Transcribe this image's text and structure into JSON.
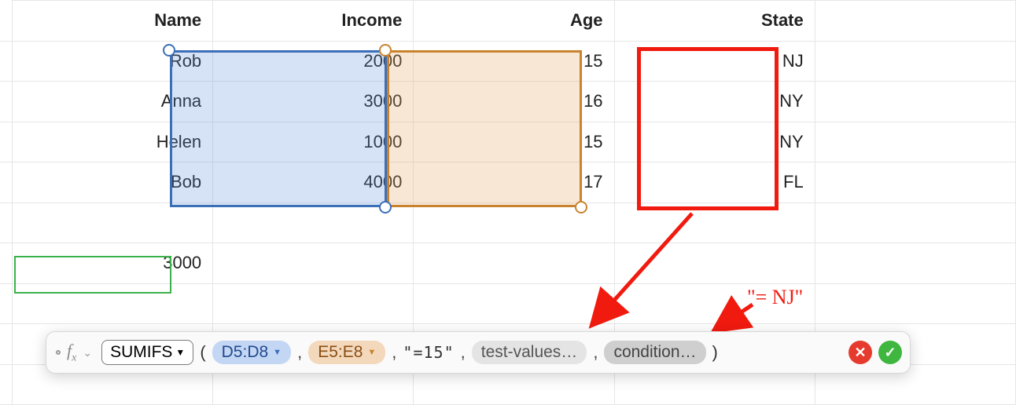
{
  "headers": {
    "name": "Name",
    "income": "Income",
    "age": "Age",
    "state": "State"
  },
  "rows": [
    {
      "name": "Rob",
      "income": "2000",
      "age": "15",
      "state": "NJ"
    },
    {
      "name": "Anna",
      "income": "3000",
      "age": "16",
      "state": "NY"
    },
    {
      "name": "Helen",
      "income": "1000",
      "age": "15",
      "state": "NY"
    },
    {
      "name": "Bob",
      "income": "4000",
      "age": "17",
      "state": "FL"
    }
  ],
  "result_cell": "3000",
  "annotation": "\"= NJ\"",
  "formula": {
    "function": "SUMIFS",
    "range1": "D5:D8",
    "range2": "E5:E8",
    "literal": "\"=15\"",
    "placeholder1": "test-values…",
    "placeholder2": "condition…"
  },
  "glyphs": {
    "fx": "f",
    "fx_sub": "x",
    "dropdown": "▼",
    "caret": "⌄",
    "cancel": "✕",
    "confirm": "✓",
    "paren_open": "(",
    "paren_close": ")",
    "comma": ","
  }
}
